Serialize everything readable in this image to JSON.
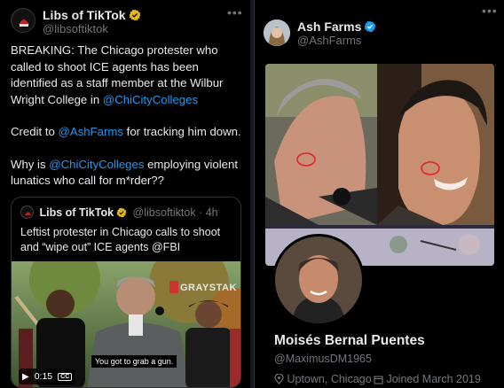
{
  "left_tweet": {
    "author_name": "Libs of TikTok",
    "author_handle": "@libsoftiktok",
    "more_icon": "ellipsis-icon",
    "p1_text": "BREAKING: The Chicago protester who called to shoot ICE agents has been identified as a staff member at the Wilbur Wright College in ",
    "p1_link": "@ChiCityColleges",
    "p2_text": "Credit to ",
    "p2_link": "@AshFarms",
    "p2_tail": " for tracking him down.",
    "p3_text": "Why is ",
    "p3_link": "@ChiCityColleges",
    "p3_tail": " employing violent lunatics who call for m*rder??",
    "quote": {
      "author_name": "Libs of TikTok",
      "author_handle": "@libsoftiktok",
      "sep": "·",
      "time": "4h",
      "text": "Leftist protester in Chicago calls to shoot and “wipe out” ICE agents @FBI",
      "video": {
        "watermark": "GRAYSTAK",
        "caption": "You got to grab a gun.",
        "time": "0:15",
        "cc_label": "CC"
      }
    }
  },
  "right_tweet": {
    "author_name": "Ash Farms",
    "author_handle": "@AshFarms",
    "more_icon": "ellipsis-icon",
    "profile": {
      "name": "Moisés Bernal Puentes",
      "handle": "@MaximusDM1965",
      "location": "Uptown, Chicago",
      "joined": "Joined March 2019"
    }
  },
  "colors": {
    "background": "#000000",
    "text": "#e7e9ea",
    "muted": "#71767b",
    "link": "#1d9bf0",
    "verified_blue": "#1d9bf0",
    "verified_gold": "#e2b719",
    "circle_red": "#e0252b"
  }
}
